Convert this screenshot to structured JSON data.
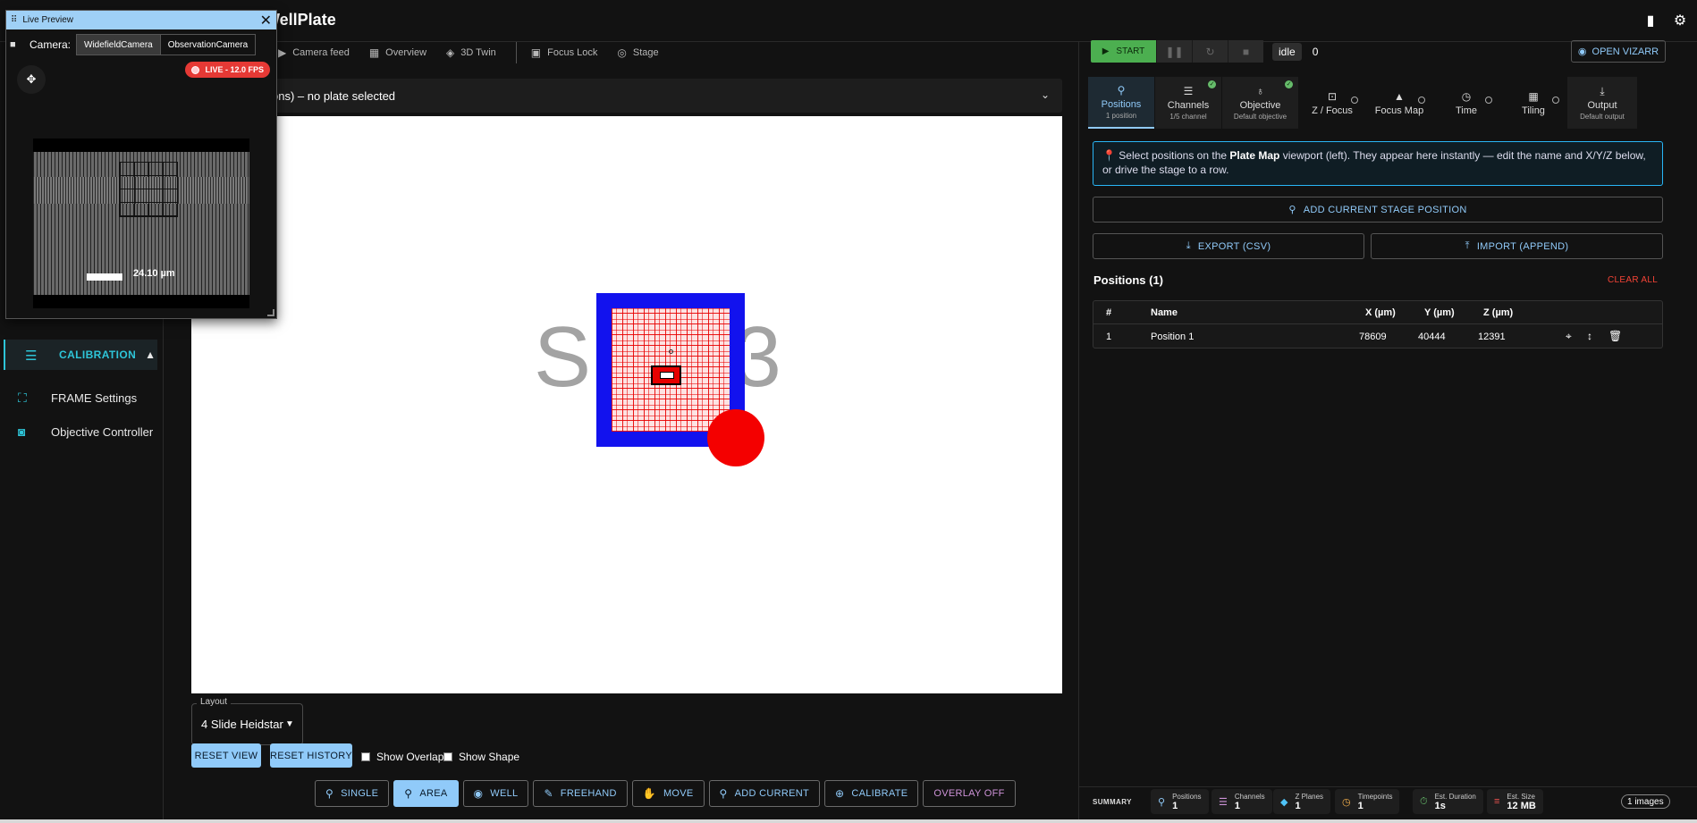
{
  "app": {
    "title_fragment": "WellPlate"
  },
  "sidebar": {
    "section": {
      "label": "CALIBRATION",
      "icon": "tune-icon"
    },
    "items": [
      {
        "label": "FRAME Settings",
        "icon": "fullscreen-icon"
      },
      {
        "label": "Objective Controller",
        "icon": "camera-icon"
      }
    ]
  },
  "view_tabs": [
    {
      "label": "Camera feed",
      "icon": "video-icon"
    },
    {
      "label": "Overview",
      "icon": "map-icon"
    },
    {
      "label": "3D Twin",
      "icon": "cube-icon"
    },
    {
      "label": "Focus Lock",
      "icon": "lock-icon"
    },
    {
      "label": "Stage",
      "icon": "target-icon"
    }
  ],
  "plate_header": {
    "text": "ons) – no plate selected"
  },
  "canvas": {
    "slide_label": "Slide3"
  },
  "layout": {
    "legend": "Layout",
    "value": "4 Slide Heidstar"
  },
  "buttons": {
    "reset_view": "RESET VIEW",
    "reset_history": "RESET HISTORY"
  },
  "checkboxes": {
    "overlap": "Show Overlap",
    "shape": "Show Shape"
  },
  "toolbar": [
    {
      "label": "SINGLE",
      "icon": "pin-icon",
      "state": "normal"
    },
    {
      "label": "AREA",
      "icon": "pin-icon",
      "state": "active"
    },
    {
      "label": "WELL",
      "icon": "circle-icon",
      "state": "normal"
    },
    {
      "label": "FREEHAND",
      "icon": "draw-icon",
      "state": "normal"
    },
    {
      "label": "MOVE",
      "icon": "hand-icon",
      "state": "normal"
    },
    {
      "label": "ADD CURRENT",
      "icon": "pin-icon",
      "state": "normal"
    },
    {
      "label": "CALIBRATE",
      "icon": "crosshair-icon",
      "state": "normal"
    },
    {
      "label": "OVERLAY OFF",
      "icon": "",
      "state": "overlay"
    }
  ],
  "live_preview": {
    "title": "Live Preview",
    "camera_label": "Camera:",
    "cameras": [
      "WidefieldCamera",
      "ObservationCamera"
    ],
    "selected_camera": "WidefieldCamera",
    "live_badge": "LIVE - 12.0 FPS",
    "scale_text": "24.10 µm"
  },
  "controls": {
    "start": "START",
    "state": "idle",
    "count": "0",
    "vizarr": "OPEN VIZARR"
  },
  "tabs": [
    {
      "label": "Positions",
      "sub": "1 position",
      "icon": "pin-icon",
      "status": "active"
    },
    {
      "label": "Channels",
      "sub": "1/5 channel",
      "icon": "tune-icon",
      "status": "ok"
    },
    {
      "label": "Objective",
      "sub": "Default objective",
      "icon": "microscope-icon",
      "status": "ok"
    },
    {
      "label": "Z / Focus",
      "sub": "",
      "icon": "focus-icon",
      "status": "empty"
    },
    {
      "label": "Focus Map",
      "sub": "",
      "icon": "terrain-icon",
      "status": "empty"
    },
    {
      "label": "Time",
      "sub": "",
      "icon": "clock-icon",
      "status": "empty"
    },
    {
      "label": "Tiling",
      "sub": "",
      "icon": "grid-icon",
      "status": "empty"
    },
    {
      "label": "Output",
      "sub": "Default output",
      "icon": "download-icon",
      "status": "filled"
    }
  ],
  "info": {
    "pre": "Select positions on the ",
    "bold": "Plate Map",
    "post": " viewport (left). They appear here instantly — edit the name and X/Y/Z below, or drive the stage to a row."
  },
  "actions": {
    "add_current": "ADD CURRENT STAGE POSITION",
    "export": "EXPORT (CSV)",
    "import": "IMPORT (APPEND)"
  },
  "positions": {
    "title": "Positions (1)",
    "clear": "CLEAR ALL",
    "headers": [
      "#",
      "Name",
      "X (µm)",
      "Y (µm)",
      "Z (µm)"
    ],
    "rows": [
      {
        "idx": "1",
        "name": "Position 1",
        "x": "78609",
        "y": "40444",
        "z": "12391"
      }
    ]
  },
  "summary": {
    "title": "SUMMARY",
    "items": [
      {
        "k": "Positions",
        "v": "1",
        "color": "#90caf9",
        "icon": "pin-icon"
      },
      {
        "k": "Channels",
        "v": "1",
        "color": "#ce93d8",
        "icon": "tune-icon"
      },
      {
        "k": "Z Planes",
        "v": "1",
        "color": "#4fc3f7",
        "icon": "layers-icon"
      },
      {
        "k": "Timepoints",
        "v": "1",
        "color": "#ffb74d",
        "icon": "clock-icon"
      },
      {
        "k": "Est. Duration",
        "v": "1s",
        "color": "#66bb6a",
        "icon": "timer-icon"
      },
      {
        "k": "Est. Size",
        "v": "12 MB",
        "color": "#ef5350",
        "icon": "storage-icon"
      }
    ],
    "images": "1 images"
  }
}
